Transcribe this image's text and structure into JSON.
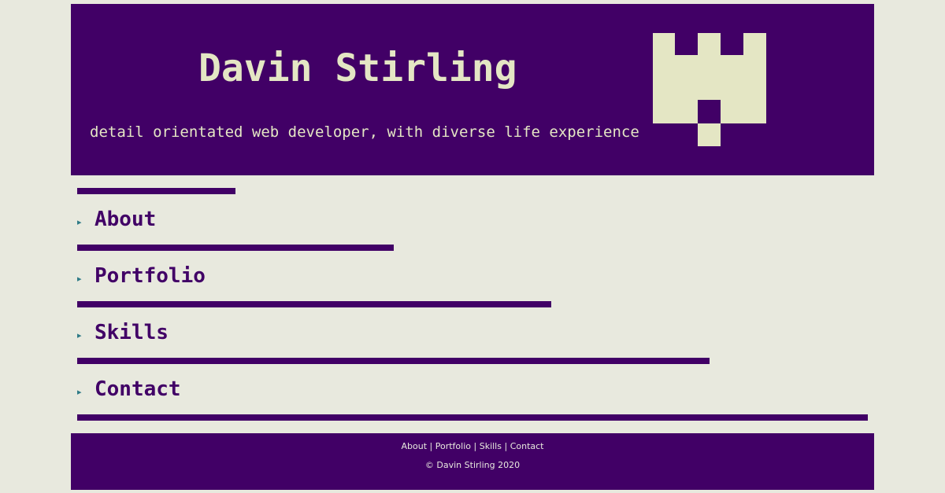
{
  "header": {
    "title": "Davin Stirling",
    "tagline": "detail orientated web developer, with diverse life experience",
    "logo_icon": "castle-icon"
  },
  "nav": {
    "arrow_glyph": "▸",
    "items": [
      {
        "label": "About"
      },
      {
        "label": "Portfolio"
      },
      {
        "label": "Skills"
      },
      {
        "label": "Contact"
      }
    ]
  },
  "footer": {
    "links": [
      {
        "label": "About"
      },
      {
        "label": "Portfolio"
      },
      {
        "label": "Skills"
      },
      {
        "label": "Contact"
      }
    ],
    "separator": "|",
    "copyright": "© Davin Stirling 2020"
  },
  "colors": {
    "background": "#e8e9de",
    "primary": "#410066",
    "logo": "#e4e6c4",
    "arrow": "#2d7a86"
  }
}
